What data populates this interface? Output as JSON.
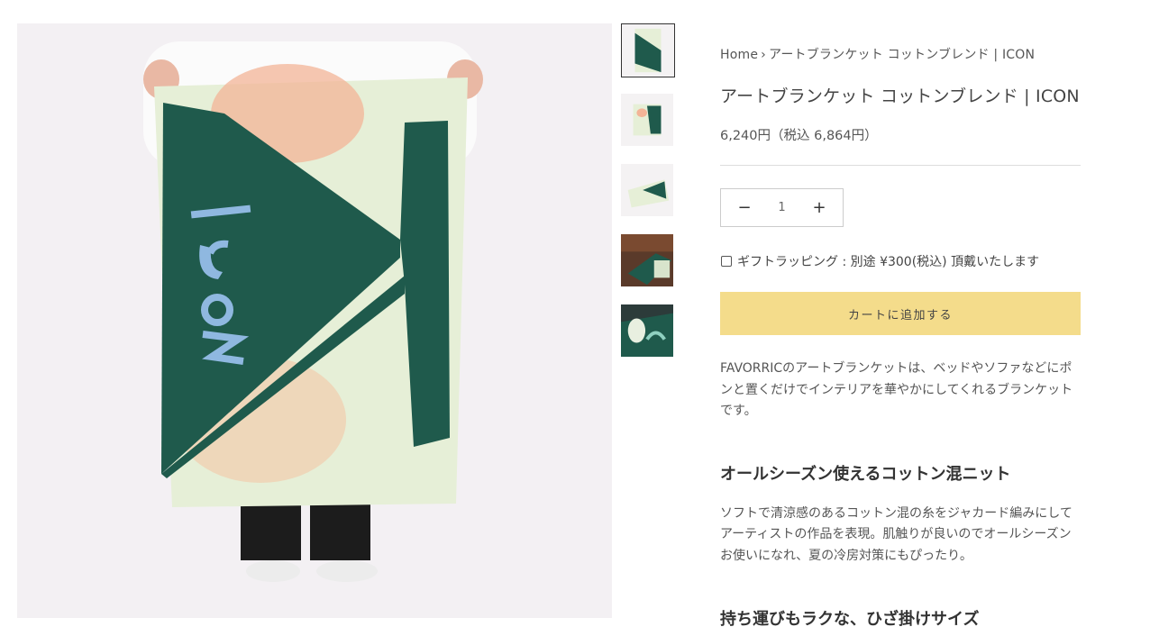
{
  "breadcrumb": {
    "home": "Home",
    "separator": "›",
    "current": "アートブランケット コットンブレンド | ICON"
  },
  "product": {
    "title": "アートブランケット コットンブレンド | ICON",
    "price": "6,240円（税込 6,864円）",
    "quantity": "1",
    "gift_label": "ギフトラッピング : 別途 ¥300(税込) 頂戴いたします",
    "add_to_cart": "カートに追加する"
  },
  "description": "FAVORRICのアートブランケットは、ベッドやソファなどにポンと置くだけでインテリアを華やかにしてくれるブランケットです。",
  "section1": {
    "heading": "オールシーズン使えるコットン混ニット",
    "body": "ソフトで清涼感のあるコットン混の糸をジャカード編みにしてアーティストの作品を表現。肌触りが良いのでオールシーズンお使いになれ、夏の冷房対策にもぴったり。"
  },
  "section2": {
    "heading": "持ち運びもラクな、ひざ掛けサイズ"
  },
  "icons": {
    "minus": "minus-icon",
    "plus": "plus-icon"
  },
  "colors": {
    "accent_button": "#f4dc8b",
    "blanket_green": "#1f5a4c"
  }
}
